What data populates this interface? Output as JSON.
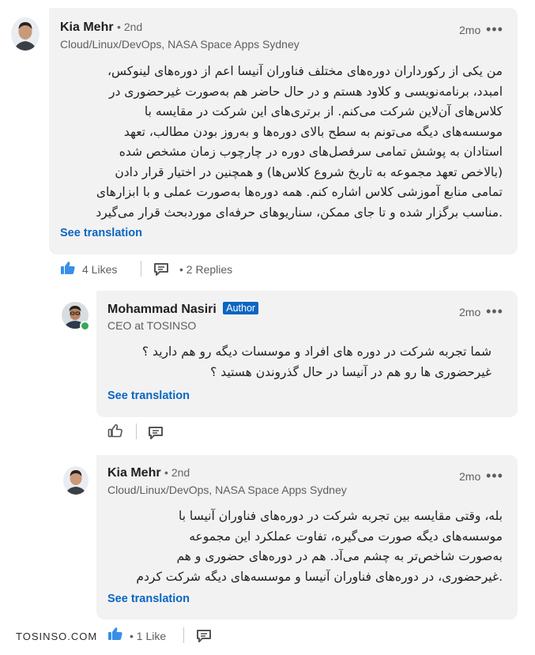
{
  "comment1": {
    "name": "Kia Mehr",
    "degree": "• 2nd",
    "headline": "Cloud/Linux/DevOps, NASA Space Apps Sydney",
    "time": "2mo",
    "lines": [
      "من یکی از رکورداران دوره‌های مختلف فناوران آنیسا اعم از دوره‌های لینوکس،",
      "امبدد، برنامه‌نویسی و کلاود هستم و در حال حاضر هم به‌صورت غیرحضوری در",
      "کلاس‌های آن‌لاین شرکت می‌کنم. از برتری‌های این شرکت در مقایسه با",
      "موسسه‌های دیگه می‌تونم به سطح بالای دوره‌ها و به‌روز بودن مطالب، تعهد",
      "استادان به پوشش تمامی سرفصل‌های دوره در چارچوب زمان مشخص شده",
      "(بالاخص تعهد مجموعه به تاریخ شروع کلاس‌ها) و همچنین در اختیار قرار دادن",
      "تمامی منابع آموزشی کلاس اشاره کنم. همه دوره‌ها به‌صورت عملی و با ابزارهای",
      ".مناسب برگزار شده و تا جای ممکن، سناریوهای حرفه‌ای موردبحث قرار می‌گیرد"
    ],
    "translate": "See translation",
    "likes": "4 Likes",
    "replies": "2 Replies"
  },
  "reply1": {
    "name": "Mohammad Nasiri",
    "badge": "Author",
    "headline": "CEO at TOSINSO",
    "time": "2mo",
    "lines": [
      "شما تجربه شرکت در دوره های افراد  و موسسات دیگه رو هم دارید ؟",
      "غیرحضوری ها رو هم در آنیسا در حال گذروندن هستید ؟"
    ],
    "translate": "See translation"
  },
  "reply2": {
    "name": "Kia Mehr",
    "degree": "• 2nd",
    "headline": "Cloud/Linux/DevOps, NASA Space Apps Sydney",
    "time": "2mo",
    "lines": [
      "بله، وقتی مقایسه بین تجربه شرکت در دوره‌های فناوران آنیسا با",
      "موسسه‌های دیگه صورت می‌گیره، تفاوت عملکرد این مجموعه",
      "به‌صورت شاخص‌تر به چشم می‌آد. هم در دوره‌های حضوری و هم",
      ".غیرحضوری، در دوره‌های فناوران آنیسا و موسسه‌های دیگه شرکت کردم"
    ],
    "translate": "See translation",
    "likes": "1 Like"
  },
  "watermark": "TOSINSO.COM",
  "colors": {
    "link": "#0a66c2",
    "bubble": "#f2f2f2",
    "badge": "#0a66c2"
  }
}
